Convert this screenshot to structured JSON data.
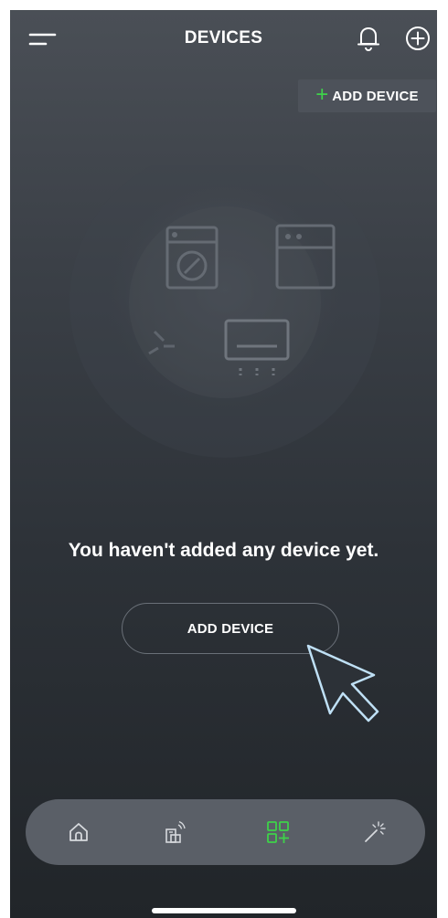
{
  "header": {
    "title": "DEVICES"
  },
  "top_add_button": {
    "plus": "+",
    "label": "ADD DEVICE"
  },
  "empty_state": {
    "message": "You haven't added any device yet.",
    "button_label": "ADD DEVICE"
  },
  "bottom_nav": {
    "items": [
      {
        "icon": "home-icon",
        "active": false
      },
      {
        "icon": "remote-devices-icon",
        "active": false
      },
      {
        "icon": "devices-grid-add-icon",
        "active": true
      },
      {
        "icon": "magic-wand-icon",
        "active": false
      }
    ]
  },
  "colors": {
    "accent_green": "#3ed24a",
    "nav_inactive": "#d6d9dd",
    "cursor_outline": "#b9dcf2"
  }
}
